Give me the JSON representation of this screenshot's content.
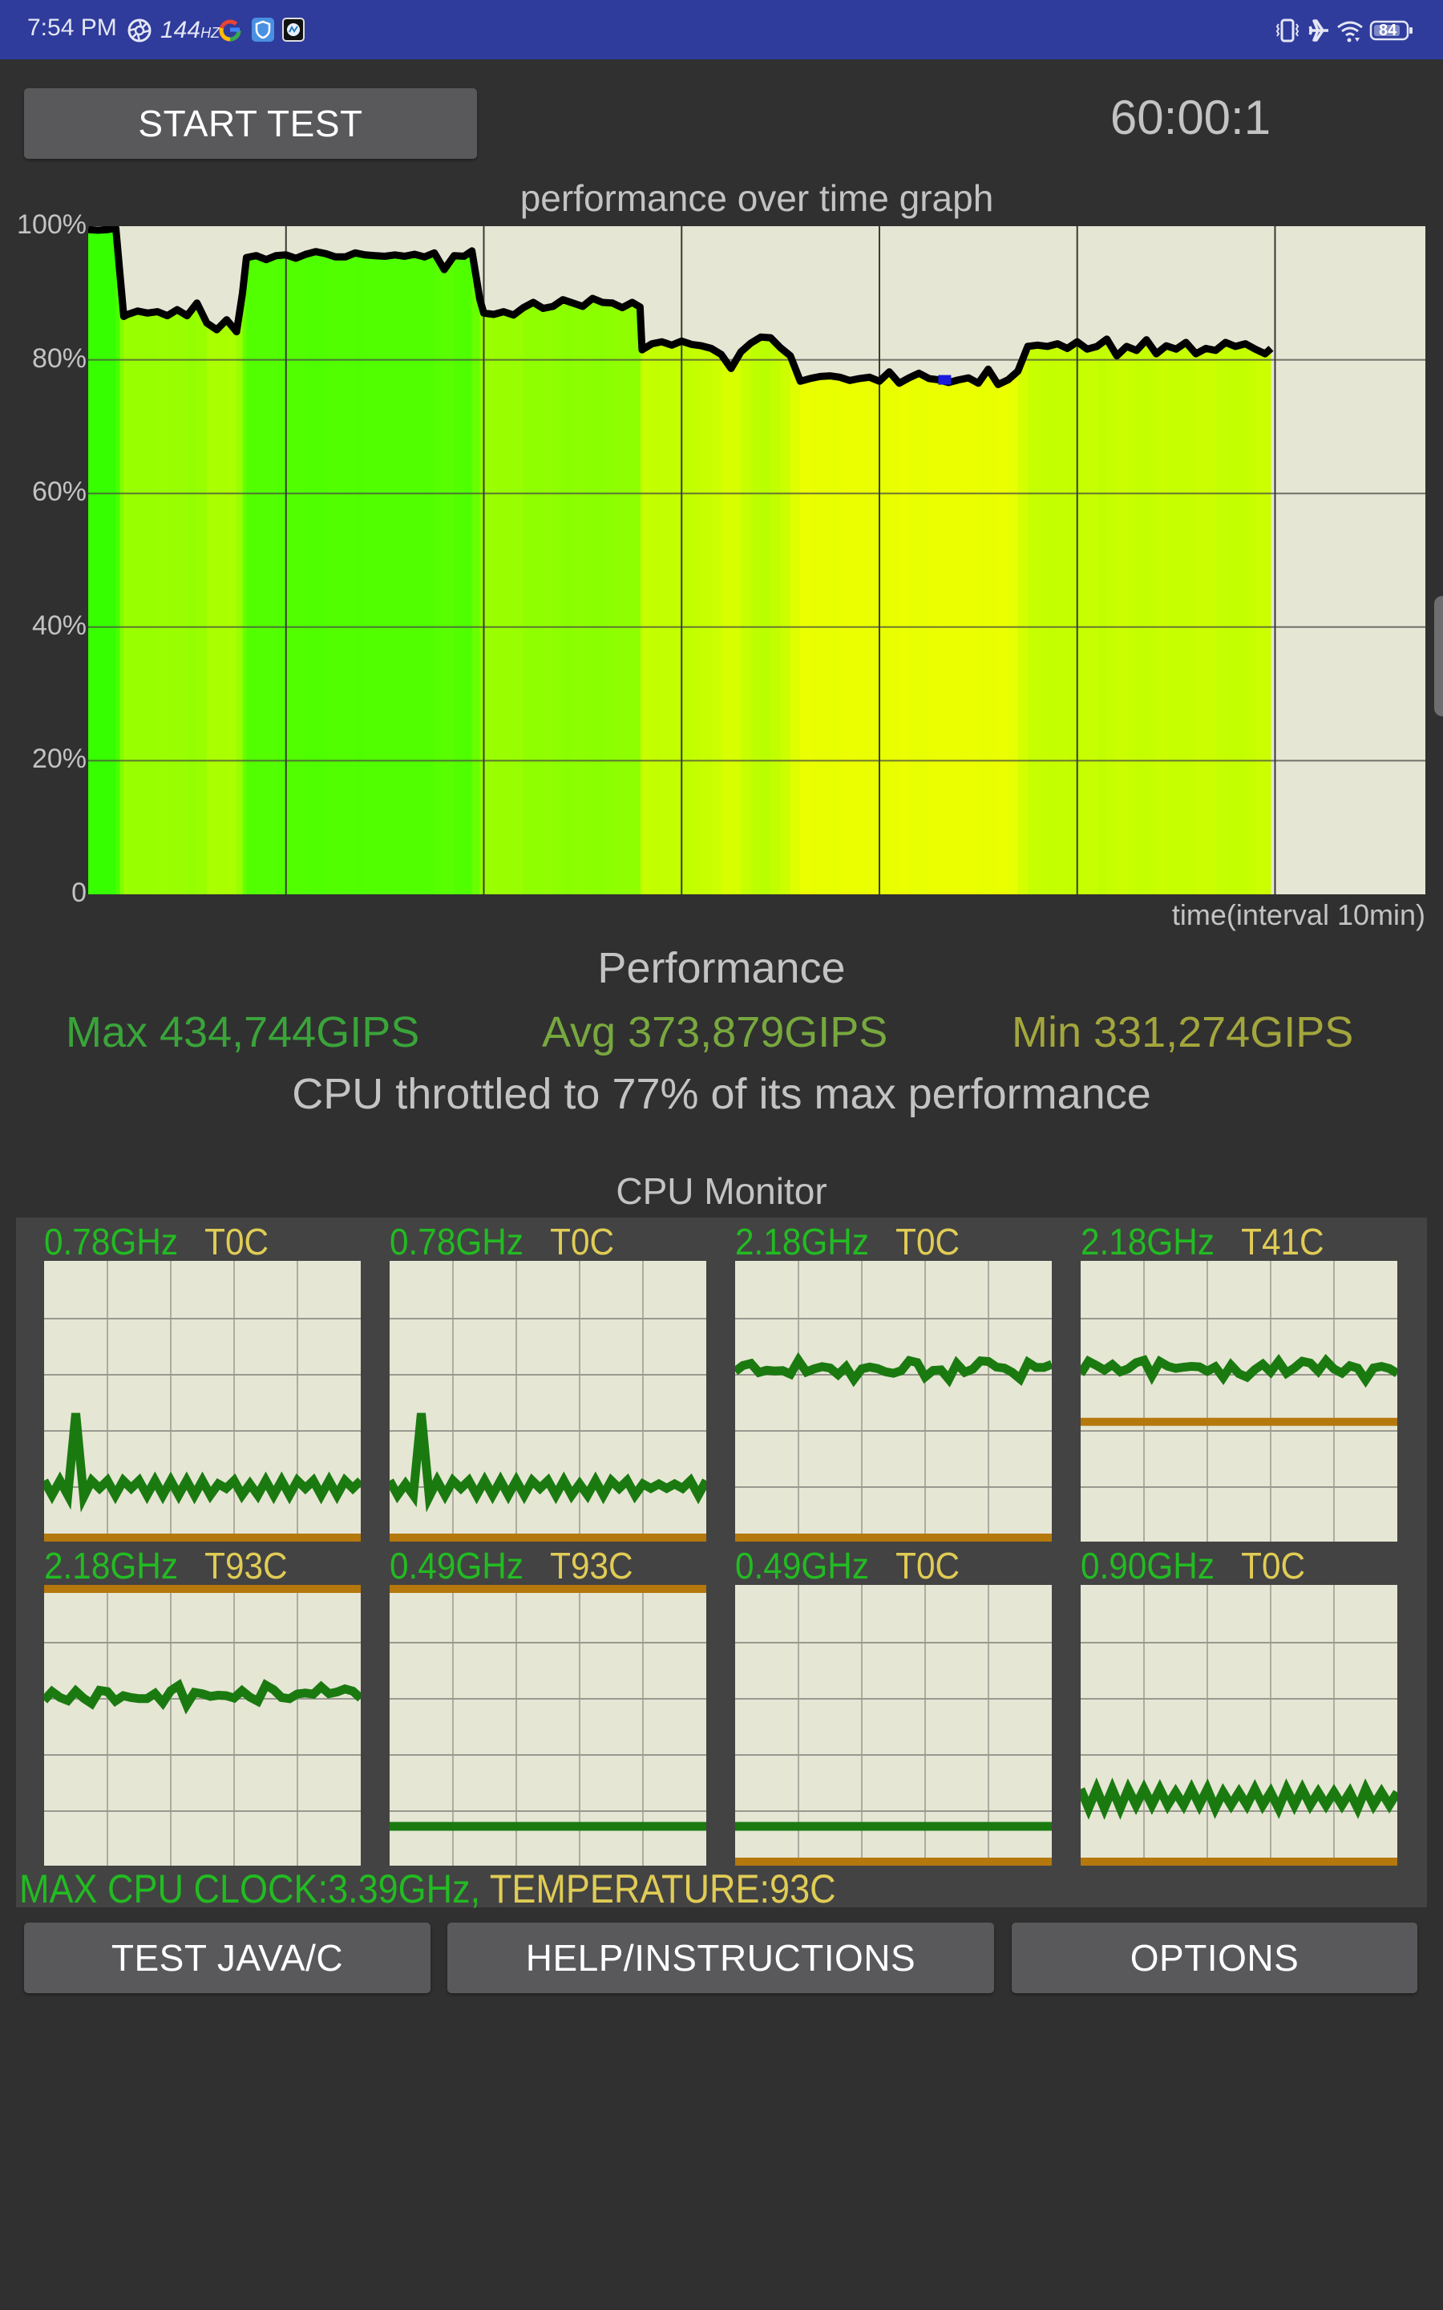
{
  "status_bar": {
    "time": "7:54 PM",
    "refresh_rate": "144",
    "refresh_unit": "HZ",
    "left_icons": [
      "aperture-icon",
      "google-icon",
      "shield-app-icon",
      "cpu-throttling-app-icon"
    ],
    "right_icons": [
      "vibrate-icon",
      "airplane-mode-icon",
      "wifi-icon",
      "battery-icon"
    ],
    "battery_level": "84",
    "color": "#2f3c9c"
  },
  "header": {
    "start_button_label": "START TEST",
    "timer": "60:00:1"
  },
  "chart_data": {
    "type": "area",
    "title": "performance over time graph",
    "xlabel": "time(interval 10min)",
    "ylabel": "",
    "y_tick_labels": [
      "100%",
      "80%",
      "60%",
      "40%",
      "20%",
      "0"
    ],
    "y_ticks": [
      100,
      80,
      60,
      40,
      20,
      0
    ],
    "ylim": [
      0,
      100
    ],
    "x_unit": "minutes",
    "x_grid_interval": 10,
    "xlim": [
      0,
      67.6
    ],
    "grid": true,
    "line_color": "#000000",
    "marker": {
      "x": 43.3,
      "y": 77,
      "color": "#1a1adc",
      "meaning": "minimum"
    },
    "series": [
      {
        "name": "performance",
        "x": [
          0,
          0.5,
          1,
          1.4,
          1.6,
          1.8,
          2,
          2.5,
          3,
          3.5,
          4,
          4.5,
          5,
          5.5,
          6,
          6.5,
          7,
          7.5,
          7.8,
          8,
          8.5,
          9,
          9.5,
          10,
          10.5,
          11,
          11.5,
          12,
          12.5,
          13,
          13.5,
          14,
          14.5,
          15,
          15.5,
          16,
          16.5,
          17,
          17.5,
          18,
          18.5,
          19,
          19.4,
          19.8,
          20,
          20.5,
          21,
          21.5,
          22,
          22.5,
          23,
          23.5,
          24,
          24.5,
          25,
          25.5,
          26,
          26.5,
          27,
          27.5,
          27.9,
          28,
          28.5,
          29,
          29.5,
          30,
          30.5,
          31,
          31.5,
          32,
          32.5,
          33,
          33.5,
          34,
          34.5,
          35,
          35.5,
          36,
          36.5,
          37,
          37.5,
          38,
          38.5,
          39,
          39.5,
          40,
          40.5,
          41,
          41.5,
          42,
          42.5,
          43,
          43.5,
          44,
          44.5,
          45,
          45.5,
          46,
          46.5,
          47,
          47.5,
          48,
          48.5,
          49,
          49.5,
          50,
          50.5,
          51,
          51.5,
          52,
          52.5,
          53,
          53.5,
          54,
          54.5,
          55,
          55.5,
          56,
          56.5,
          57,
          57.5,
          58,
          58.5,
          59,
          59.5,
          59.8
        ],
        "y": [
          99.5,
          99.4,
          99.5,
          99.7,
          93,
          86.5,
          86.8,
          87.3,
          87.0,
          87.2,
          86.6,
          87.5,
          86.6,
          88.5,
          85.5,
          84.5,
          86,
          84.2,
          90,
          95.3,
          95.6,
          95.0,
          95.6,
          95.7,
          95.2,
          95.8,
          96.2,
          95.9,
          95.4,
          95.4,
          96.0,
          95.7,
          95.6,
          95.5,
          95.7,
          95.5,
          95.8,
          95.4,
          96.0,
          93.5,
          95.6,
          95.5,
          96.3,
          89,
          87.0,
          86.8,
          87.2,
          86.7,
          87.8,
          88.6,
          87.7,
          88.0,
          89.0,
          88.5,
          88.0,
          89.2,
          88.6,
          88.5,
          87.8,
          88.6,
          87.9,
          81.5,
          82.4,
          82.7,
          82.2,
          82.8,
          82.3,
          82.1,
          81.7,
          80.8,
          78.7,
          81.2,
          82.5,
          83.4,
          83.3,
          81.8,
          80.6,
          76.8,
          77.2,
          77.5,
          77.6,
          77.4,
          76.9,
          77.2,
          77.4,
          76.8,
          78.2,
          76.5,
          77.3,
          78.0,
          77.2,
          77.0,
          76.6,
          77.0,
          77.3,
          76.5,
          78.6,
          76.3,
          77.0,
          78.3,
          82.0,
          82.2,
          82.0,
          82.4,
          81.7,
          82.7,
          81.6,
          82.0,
          83.1,
          80.6,
          82.0,
          81.4,
          83.0,
          80.9,
          82.1,
          81.6,
          82.6,
          80.9,
          81.7,
          81.4,
          82.6,
          82.0,
          82.4,
          81.6,
          80.9,
          81.7,
          82.2
        ]
      }
    ],
    "fill_gradient_stops_by_perf": [
      {
        "perf": 100,
        "color": "#33ff00"
      },
      {
        "perf": 95,
        "color": "#55ff00"
      },
      {
        "perf": 87,
        "color": "#99ff00"
      },
      {
        "perf": 82,
        "color": "#c6ff00"
      },
      {
        "perf": 77,
        "color": "#ecff00"
      }
    ]
  },
  "performance": {
    "heading": "Performance",
    "max_label": "Max 434,744GIPS",
    "avg_label": "Avg 373,879GIPS",
    "min_label": "Min 331,274GIPS",
    "max_color": "#3aa43a",
    "avg_color": "#78a83e",
    "min_color": "#a3a63c",
    "throttle_text": "CPU throttled to 77% of its max performance"
  },
  "cpu_monitor": {
    "title": "CPU Monitor",
    "freq_color": "#22bb22",
    "temp_color": "#e0cc55",
    "load_color": "#1a7a10",
    "temp_bar_color": "#b5780c",
    "cores": [
      {
        "freq": "0.78GHz",
        "temp": "T0C",
        "load_level": 0.2,
        "pattern": "spike",
        "temp_level": 0.0
      },
      {
        "freq": "0.78GHz",
        "temp": "T0C",
        "load_level": 0.2,
        "pattern": "spike",
        "temp_level": 0.0
      },
      {
        "freq": "2.18GHz",
        "temp": "T0C",
        "load_level": 0.62,
        "pattern": "wave",
        "temp_level": 0.0
      },
      {
        "freq": "2.18GHz",
        "temp": "T41C",
        "load_level": 0.62,
        "pattern": "wave",
        "temp_level": 0.44
      },
      {
        "freq": "2.18GHz",
        "temp": "T93C",
        "load_level": 0.62,
        "pattern": "wave",
        "temp_level": 1.0
      },
      {
        "freq": "0.49GHz",
        "temp": "T93C",
        "load_level": 0.14,
        "pattern": "flat",
        "temp_level": 1.0
      },
      {
        "freq": "0.49GHz",
        "temp": "T0C",
        "load_level": 0.14,
        "pattern": "flat",
        "temp_level": 0.0
      },
      {
        "freq": "0.90GHz",
        "temp": "T0C",
        "load_level": 0.25,
        "pattern": "zigzag",
        "temp_level": 0.0
      }
    ],
    "footer_clock": "MAX CPU CLOCK:3.39GHz,",
    "footer_temp": "TEMPERATURE:93C"
  },
  "bottom_buttons": {
    "test_java_c": "TEST JAVA/C",
    "help_instructions": "HELP/INSTRUCTIONS",
    "options": "OPTIONS"
  }
}
